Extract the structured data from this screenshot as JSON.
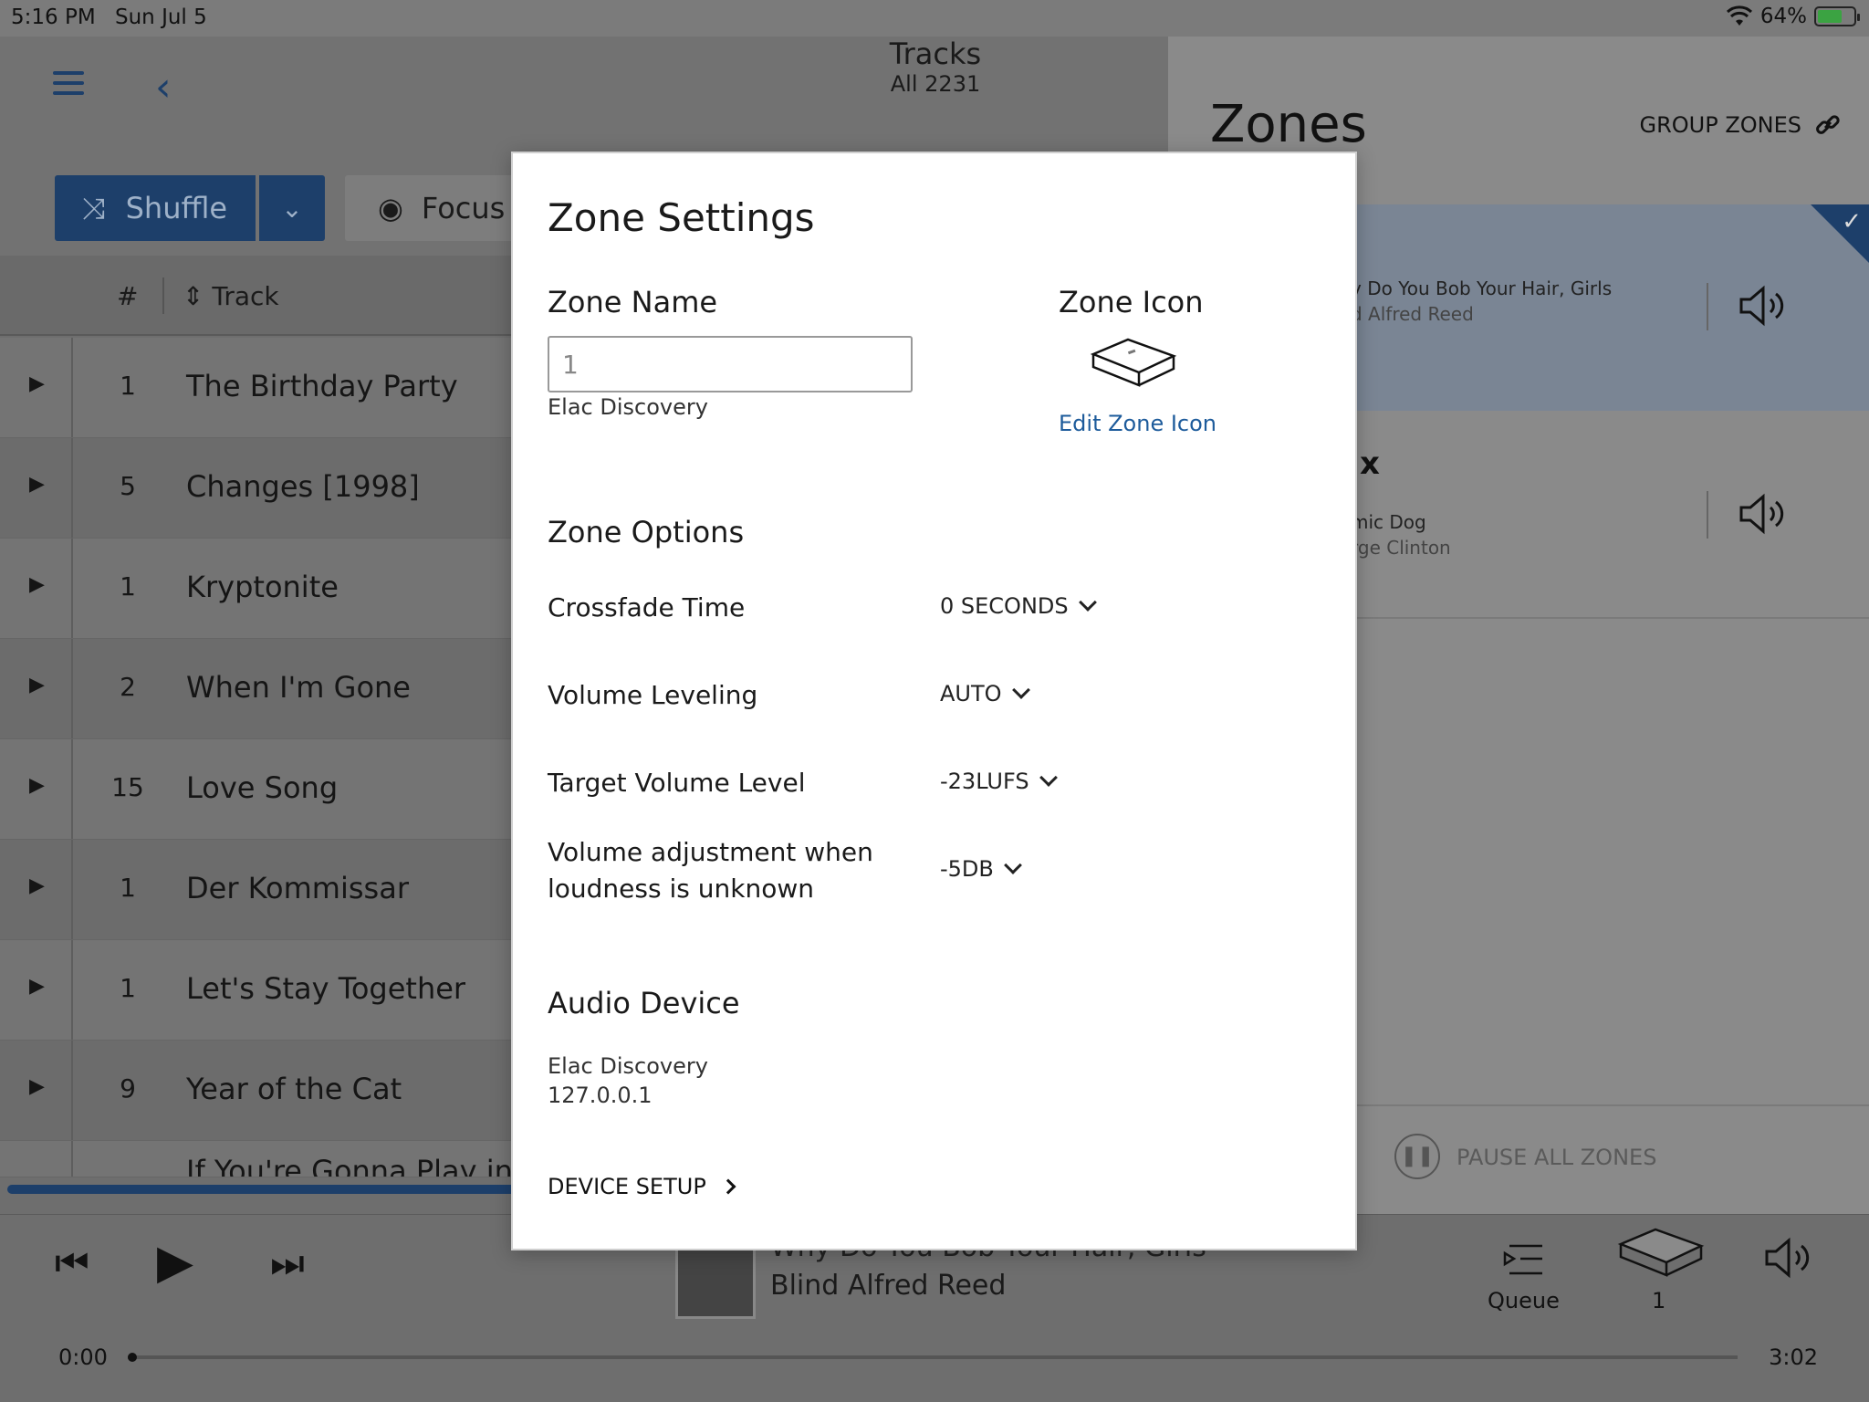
{
  "status_bar": {
    "time": "5:16 PM",
    "date": "Sun Jul 5",
    "battery": "64%"
  },
  "library": {
    "title": "Tracks",
    "subtitle": "All 2231",
    "shuffle_label": "Shuffle",
    "focus_label": "Focus",
    "columns": {
      "num": "#",
      "track": "Track"
    },
    "rows": [
      {
        "num": "1",
        "name": "The Birthday Party"
      },
      {
        "num": "5",
        "name": "Changes [1998]"
      },
      {
        "num": "1",
        "name": "Kryptonite"
      },
      {
        "num": "2",
        "name": "When I'm Gone"
      },
      {
        "num": "15",
        "name": "Love Song"
      },
      {
        "num": "1",
        "name": "Der Kommissar"
      },
      {
        "num": "1",
        "name": "Let's Stay Together"
      },
      {
        "num": "9",
        "name": "Year of the Cat"
      },
      {
        "num": "",
        "name": "If You're Gonna Play in T"
      }
    ]
  },
  "zones": {
    "title": "Zones",
    "group_label": "GROUP ZONES",
    "cards": [
      {
        "line1": "y Do You Bob Your Hair, Girls",
        "line2": "d Alfred Reed"
      },
      {
        "name_partial": "x",
        "line1": "mic Dog",
        "line2": "rge Clinton"
      }
    ],
    "pause_all": "PAUSE ALL ZONES"
  },
  "player": {
    "now_title": "Why Do You Bob Your Hair, Girls",
    "now_artist": "Blind Alfred Reed",
    "queue_label": "Queue",
    "zone_label": "1",
    "time_start": "0:00",
    "time_end": "3:02"
  },
  "modal": {
    "title": "Zone Settings",
    "zone_name_label": "Zone Name",
    "zone_name_value": "1",
    "zone_device": "Elac Discovery",
    "zone_icon_label": "Zone Icon",
    "edit_icon_label": "Edit Zone Icon",
    "options_label": "Zone Options",
    "options": [
      {
        "label": "Crossfade Time",
        "value": "0 SECONDS"
      },
      {
        "label": "Volume Leveling",
        "value": "AUTO"
      },
      {
        "label": "Target Volume Level",
        "value": "-23LUFS"
      },
      {
        "label": "Volume adjustment when loudness is unknown",
        "value": "-5DB"
      }
    ],
    "audio_device_label": "Audio Device",
    "audio_device_name": "Elac Discovery",
    "audio_device_ip": "127.0.0.1",
    "device_setup_label": "DEVICE SETUP"
  }
}
